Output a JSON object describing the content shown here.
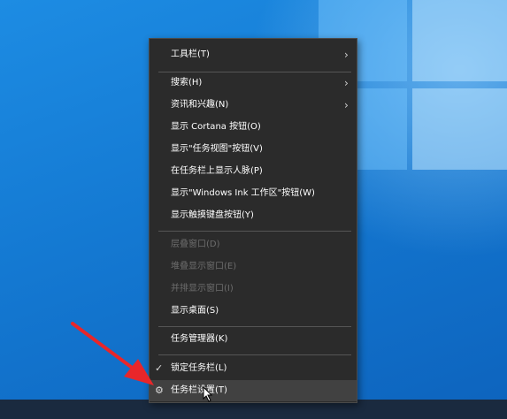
{
  "menu": {
    "items": [
      {
        "label": "工具栏(T)",
        "chevron": "chevron-right-icon",
        "enabled": true
      },
      {
        "label": "搜索(H)",
        "chevron": "chevron-right-icon",
        "enabled": true
      },
      {
        "label": "资讯和兴趣(N)",
        "chevron": "chevron-right-icon",
        "enabled": true
      },
      {
        "label": "显示 Cortana 按钮(O)",
        "enabled": true
      },
      {
        "label": "显示\"任务视图\"按钮(V)",
        "enabled": true
      },
      {
        "label": "在任务栏上显示人脉(P)",
        "enabled": true
      },
      {
        "label": "显示\"Windows Ink 工作区\"按钮(W)",
        "enabled": true
      },
      {
        "label": "显示触摸键盘按钮(Y)",
        "enabled": true
      },
      {
        "label": "层叠窗口(D)",
        "enabled": false
      },
      {
        "label": "堆叠显示窗口(E)",
        "enabled": false
      },
      {
        "label": "并排显示窗口(I)",
        "enabled": false
      },
      {
        "label": "显示桌面(S)",
        "enabled": true
      },
      {
        "label": "任务管理器(K)",
        "enabled": true
      },
      {
        "label": "锁定任务栏(L)",
        "checked": true,
        "enabled": true
      },
      {
        "label": "任务栏设置(T)",
        "icon": "gear-icon",
        "enabled": true,
        "hovered": true
      }
    ]
  },
  "colors": {
    "menu_bg": "#2b2b2b",
    "hover_bg": "#414141",
    "disabled_text": "#6d6d6d",
    "annotation_arrow": "#e8262a"
  }
}
